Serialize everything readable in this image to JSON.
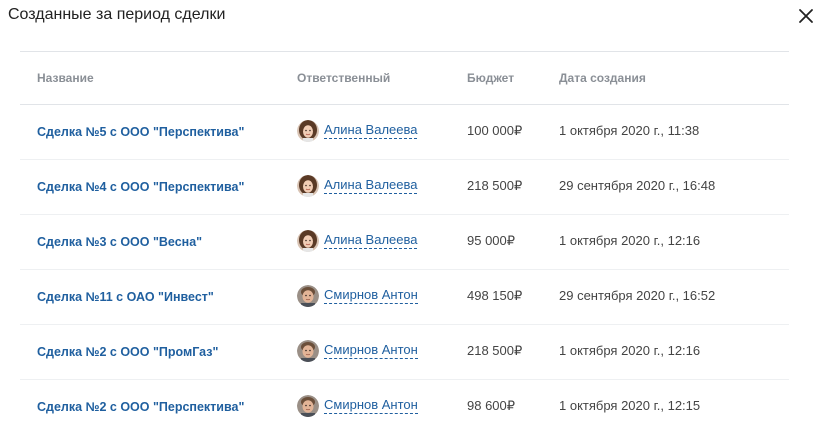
{
  "dialog": {
    "title": "Созданные за период сделки",
    "close_icon": "close-icon"
  },
  "table": {
    "headers": {
      "name": "Название",
      "responsible": "Ответственный",
      "budget": "Бюджет",
      "created": "Дата создания"
    },
    "rows": [
      {
        "name": "Сделка №5 с ООО \"Перспектива\"",
        "responsible": "Алина Валеева",
        "avatar": "female-avatar",
        "budget": "100 000₽",
        "created": "1 октября 2020 г., 11:38"
      },
      {
        "name": "Сделка №4 с ООО \"Перспектива\"",
        "responsible": "Алина Валеева",
        "avatar": "female-avatar",
        "budget": "218 500₽",
        "created": "29 сентября 2020 г., 16:48"
      },
      {
        "name": "Сделка №3 с ООО \"Весна\"",
        "responsible": "Алина Валеева",
        "avatar": "female-avatar",
        "budget": "95 000₽",
        "created": "1 октября 2020 г., 12:16"
      },
      {
        "name": "Сделка №11 с ОАО \"Инвест\"",
        "responsible": "Смирнов Антон",
        "avatar": "male-avatar",
        "budget": "498 150₽",
        "created": "29 сентября 2020 г., 16:52"
      },
      {
        "name": "Сделка №2 с ООО \"ПромГаз\"",
        "responsible": "Смирнов Антон",
        "avatar": "male-avatar",
        "budget": "218 500₽",
        "created": "1 октября 2020 г., 12:16"
      },
      {
        "name": "Сделка №2 с ООО \"Перспектива\"",
        "responsible": "Смирнов Антон",
        "avatar": "male-avatar",
        "budget": "98 600₽",
        "created": "1 октября 2020 г., 12:15"
      }
    ]
  },
  "colors": {
    "link": "#1f5f9f",
    "header_text": "#8a8f96"
  }
}
